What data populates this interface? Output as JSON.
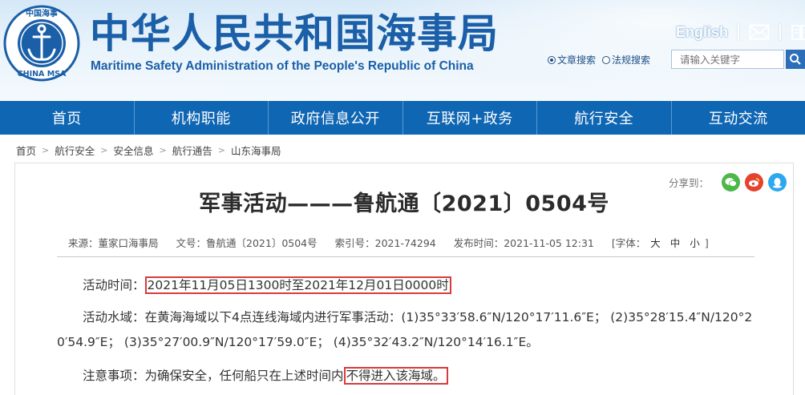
{
  "header": {
    "title": "中华人民共和国海事局",
    "subtitle": "Maritime Safety Administration of the People's Republic of China",
    "emblem_text_top": "中国海事",
    "emblem_text_bottom": "CHINA MSA",
    "english_link": "English",
    "search": {
      "options": [
        "文章搜索",
        "法规搜索"
      ],
      "selected": "文章搜索",
      "placeholder": "请输入关键字"
    }
  },
  "nav": {
    "items": [
      "首页",
      "机构职能",
      "政府信息公开",
      "互联网+政务",
      "航行安全",
      "互动交流"
    ]
  },
  "breadcrumb": [
    "首页",
    "航行安全",
    "安全信息",
    "航行通告",
    "山东海事局"
  ],
  "article": {
    "share_label": "分享到：",
    "title": "军事活动———鲁航通〔2021〕0504号",
    "meta": {
      "source": "来源：董家口海事局",
      "doc_no": "文号：鲁航通〔2021〕0504号",
      "index_no": "索引号：2021-74294",
      "published": "发布时间：2021-11-05 12:31",
      "font_label": "[字体：",
      "font_large": "大",
      "font_mid": "中",
      "font_small": "小",
      "font_close": "]"
    },
    "time_label": "活动时间：",
    "time_value": "2021年11月05日1300时至2021年12月01日0000时",
    "area_line1": "活动水域：在黄海海域以下4点连线海域内进行军事活动：(1)35°33′58.6″N/120°17′11.6″E；  (2)35°28′15.4″N/120°2",
    "area_line2": "0′54.9″E；  (3)35°27′00.9″N/120°17′59.0″E；  (4)35°32′43.2″N/120°14′16.1″E。",
    "notice_label": "注意事项：为确保安全，任何船只在上述时间内",
    "notice_value": "不得进入该海域。"
  },
  "colors": {
    "brand_blue": "#1a5fa8",
    "nav_blue": "#0f66b3",
    "highlight_red": "#d93b3b"
  }
}
